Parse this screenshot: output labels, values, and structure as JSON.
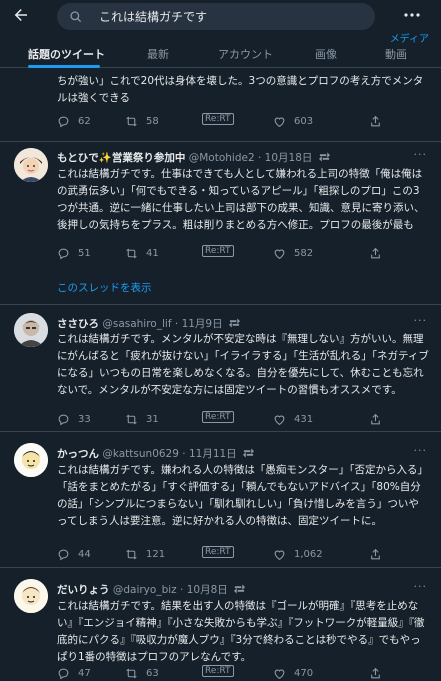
{
  "search": {
    "query": "これは結構ガチです"
  },
  "header": {
    "media_link": "メディア"
  },
  "tabs": [
    {
      "label": "話題のツイート"
    },
    {
      "label": "最新"
    },
    {
      "label": "アカウント"
    },
    {
      "label": "画像"
    },
    {
      "label": "動画"
    }
  ],
  "tweets": [
    {
      "body": "ちが強い」これで20代は身体を壊した。3つの意識とプロフの考え方でメンタルは強くできる",
      "reply": "62",
      "retweet": "58",
      "rert": "Re:RT",
      "like": "603"
    },
    {
      "name": "もとひで✨営業祭り参加中",
      "handle": "@Motohide2",
      "date": "10月18日",
      "body": "これは結構ガチです。仕事はできても人として嫌われる上司の特徴「俺は俺はの武勇伝多い」「何でもできる・知っているアピール」「粗探しのプロ」この3つが共通。逆に一緒に仕事したい上司は部下の成果、知識、意見に寄り添い、後押しの気持ちをプラス。粗は削りまとめる方へ修正。プロフの最後が最も",
      "reply": "51",
      "retweet": "41",
      "rert": "Re:RT",
      "like": "582",
      "thread": "このスレッドを表示"
    },
    {
      "name": "ささひろ",
      "handle": "@sasahiro_lif",
      "date": "11月9日",
      "body": "これは結構ガチです。メンタルが不安定な時は『無理しない』方がいい。無理にがんばると「疲れが抜けない」「イライラする」「生活が乱れる」「ネガティブになる」いつもの日常を楽しめなくなる。自分を優先にして、休むことも忘れないで。メンタルが不安定な方には固定ツイートの習慣もオススメです。",
      "reply": "33",
      "retweet": "31",
      "rert": "Re:RT",
      "like": "431"
    },
    {
      "name": "かっつん",
      "handle": "@kattsun0629",
      "date": "11月11日",
      "body": "これは結構ガチです。嫌われる人の特徴は「愚痴モンスター」「否定から入る」「話をまとめたがる」「すぐ評価する」「頼んでもないアドバイス」「80%自分の話」「シンプルにつまらない」「馴れ馴れしい」「負け惜しみを言う」ついやってしまう人は要注意。逆に好かれる人の特徴は、固定ツイートに。",
      "reply": "44",
      "retweet": "121",
      "rert": "Re:RT",
      "like": "1,062"
    },
    {
      "name": "だいりょう",
      "handle": "@dairyo_biz",
      "date": "10月8日",
      "body": "これは結構ガチです。結果を出す人の特徴は『ゴールが明確』『思考を止めない』『エンジョイ精神』『小さな失敗からも学ぶ』『フットワークが軽量級』『徹底的にパクる』『吸収力が魔人ブウ』『3分で終わることは秒でやる』でもやっぱり1番の特徴はプロフのアレなんです。",
      "reply": "47",
      "retweet": "63",
      "rert": "Re:RT",
      "like": "470"
    }
  ],
  "colors": {
    "bg": "#15202b",
    "accent": "#1d9bf0",
    "muted": "#8b98a5",
    "text": "#e7e9ea",
    "divider": "#38444d"
  }
}
